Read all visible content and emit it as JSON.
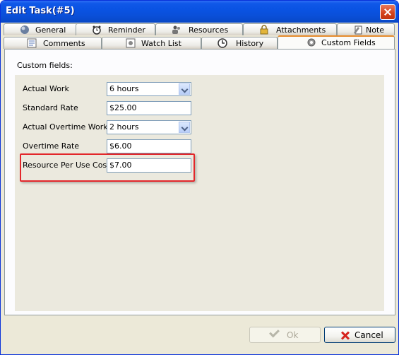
{
  "window": {
    "title": "Edit Task(#5)"
  },
  "tabs_row1": [
    {
      "label": "General",
      "icon": "globe-icon"
    },
    {
      "label": "Reminder",
      "icon": "alarm-clock-icon"
    },
    {
      "label": "Resources",
      "icon": "resources-icon"
    },
    {
      "label": "Attachments",
      "icon": "lock-icon"
    },
    {
      "label": "Note",
      "icon": "note-icon"
    }
  ],
  "tabs_row2": [
    {
      "label": "Comments",
      "icon": "comments-icon"
    },
    {
      "label": "Watch List",
      "icon": "watch-list-icon"
    },
    {
      "label": "History",
      "icon": "history-icon"
    },
    {
      "label": "Custom Fields",
      "icon": "gear-icon",
      "active": true
    }
  ],
  "panel": {
    "custom_fields_label": "Custom fields:"
  },
  "fields": [
    {
      "label": "Actual Work",
      "value": "6 hours",
      "type": "dropdown"
    },
    {
      "label": "Standard Rate",
      "value": "$25.00",
      "type": "text"
    },
    {
      "label": "Actual Overtime Work",
      "value": "2 hours",
      "type": "dropdown"
    },
    {
      "label": "Overtime Rate",
      "value": "$6.00",
      "type": "text"
    },
    {
      "label": "Resource Per Use Cost",
      "value": "$7.00",
      "type": "text",
      "highlighted": true
    }
  ],
  "buttons": {
    "ok": "Ok",
    "cancel": "Cancel"
  },
  "colors": {
    "title_bar": "#0a53e3",
    "highlight_border": "#e3272b",
    "active_tab_accent": "#e68b2c"
  }
}
